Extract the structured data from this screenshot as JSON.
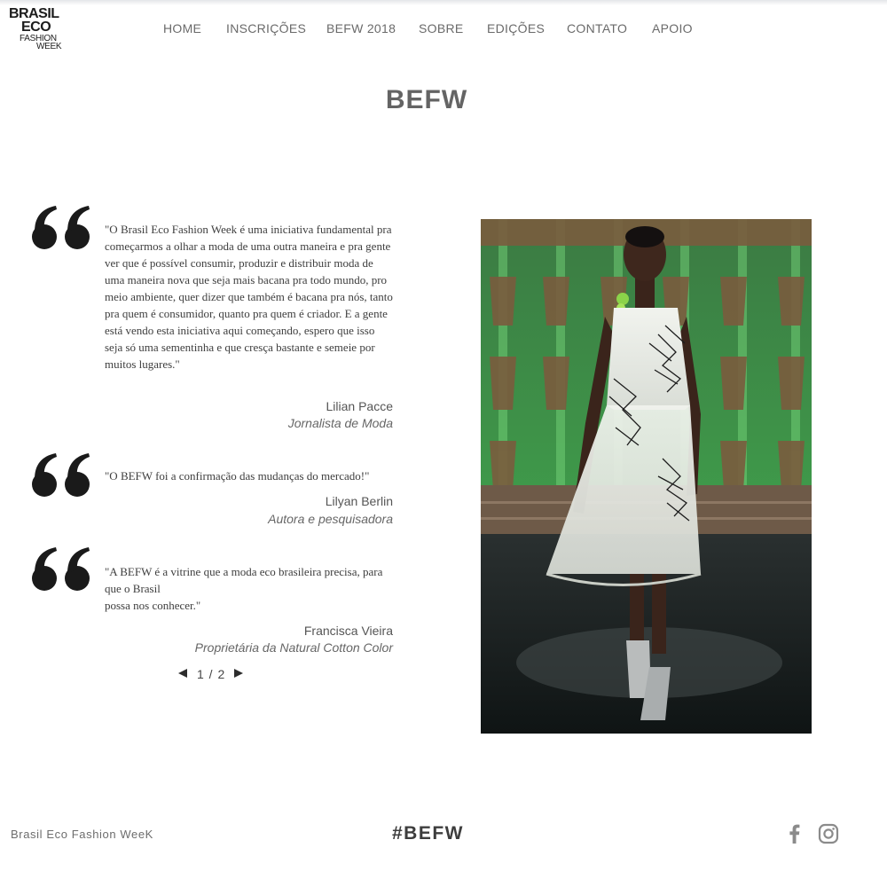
{
  "logo": {
    "line1": "BRASIL",
    "line2": "ECO",
    "line3": "FASHION",
    "line4": "WEEK"
  },
  "nav": [
    "HOME",
    "INSCRIÇÕES",
    "BEFW 2018",
    "SOBRE",
    "EDIÇÕES",
    "CONTATO",
    "APOIO"
  ],
  "page_title": "BEFW",
  "testimonials": [
    {
      "quote": "\"O Brasil Eco Fashion Week é uma iniciativa fundamental pra começarmos a olhar a moda de uma outra maneira e pra gente ver que é possível consumir, produzir e distribuir moda de uma maneira nova que seja mais bacana pra todo mundo, pro meio ambiente, quer dizer que também é bacana pra nós, tanto pra quem é consumidor, quanto pra quem é criador. E a gente está vendo esta iniciativa aqui começando, espero que isso seja só uma sementinha e que cresça bastante e semeie por muitos lugares.\"",
      "author": "Lilian Pacce",
      "role": "Jornalista de Moda"
    },
    {
      "quote": "\"O BEFW foi a confirmação das mudanças do mercado!\"",
      "author": "Lilyan Berlin",
      "role": "Autora e pesquisadora"
    },
    {
      "quote": "\"A BEFW é a vitrine que a moda eco brasileira precisa, para que o Brasil\npossa nos conhecer.\"",
      "author": "Francisca Vieira",
      "role": "Proprietária da Natural Cotton Color"
    }
  ],
  "pager": {
    "count": "1 / 2"
  },
  "footer": {
    "brand": "Brasil Eco Fashion WeeK",
    "hashtag": "#BEFW"
  },
  "icons": {
    "quote": "quote-icon",
    "facebook": "facebook-icon",
    "instagram": "instagram-icon"
  },
  "colors": {
    "nav_text": "#6a6a6a",
    "title": "#646464",
    "quote_mark": "#1a1a1a",
    "photo_green": "#3f9a4a"
  }
}
